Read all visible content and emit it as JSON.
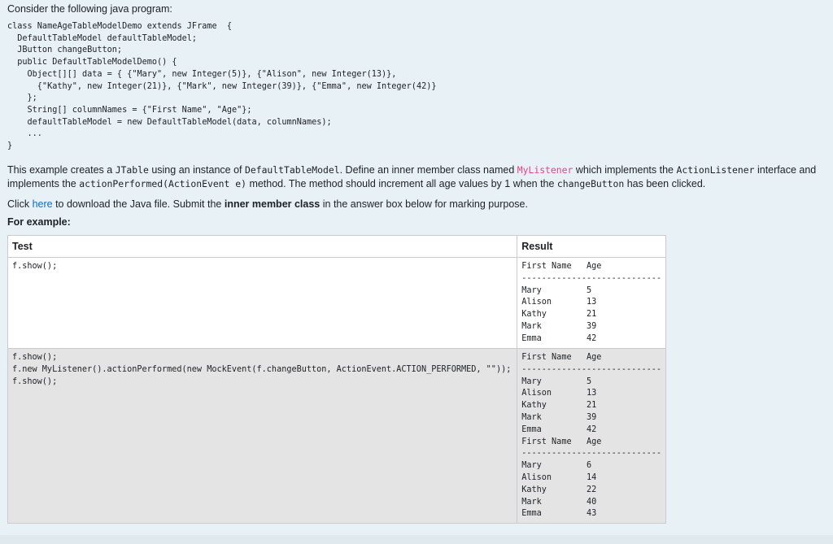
{
  "intro": "Consider the following java program:",
  "code": "class NameAgeTableModelDemo extends JFrame  {\n  DefaultTableModel defaultTableModel;\n  JButton changeButton;\n  public DefaultTableModelDemo() {\n    Object[][] data = { {\"Mary\", new Integer(5)}, {\"Alison\", new Integer(13)},\n      {\"Kathy\", new Integer(21)}, {\"Mark\", new Integer(39)}, {\"Emma\", new Integer(42)}\n    };\n    String[] columnNames = {\"First Name\", \"Age\"};\n    defaultTableModel = new DefaultTableModel(data, columnNames);\n    ...\n}",
  "para1": {
    "t1": "This example creates a ",
    "c1": "JTable",
    "t2": " using an instance of ",
    "c2": "DefaultTableModel",
    "t3": ". Define an inner member class named ",
    "c3": "MyListener",
    "t4": " which implements the ",
    "c4": "ActionListener",
    "t5": " interface and implements the ",
    "c5": "actionPerformed(ActionEvent e)",
    "t6": " method. The method should increment all age values by 1 when the ",
    "c6": "changeButton",
    "t7": " has been clicked."
  },
  "para2": {
    "t1": "Click ",
    "link": "here",
    "t2": " to download the Java file. Submit the ",
    "bold": "inner member class",
    "t3": " in the answer box below for marking purpose."
  },
  "example_label": "For example:",
  "table": {
    "headers": [
      "Test",
      "Result"
    ],
    "rows": [
      {
        "test": "f.show();",
        "result": "First Name   Age\n----------------------------\nMary         5\nAlison       13\nKathy        21\nMark         39\nEmma         42"
      },
      {
        "test": "f.show();\nf.new MyListener().actionPerformed(new MockEvent(f.changeButton, ActionEvent.ACTION_PERFORMED, \"\"));\nf.show();",
        "result": "First Name   Age\n----------------------------\nMary         5\nAlison       13\nKathy        21\nMark         39\nEmma         42\nFirst Name   Age\n----------------------------\nMary         6\nAlison       14\nKathy        22\nMark         40\nEmma         43"
      }
    ]
  }
}
